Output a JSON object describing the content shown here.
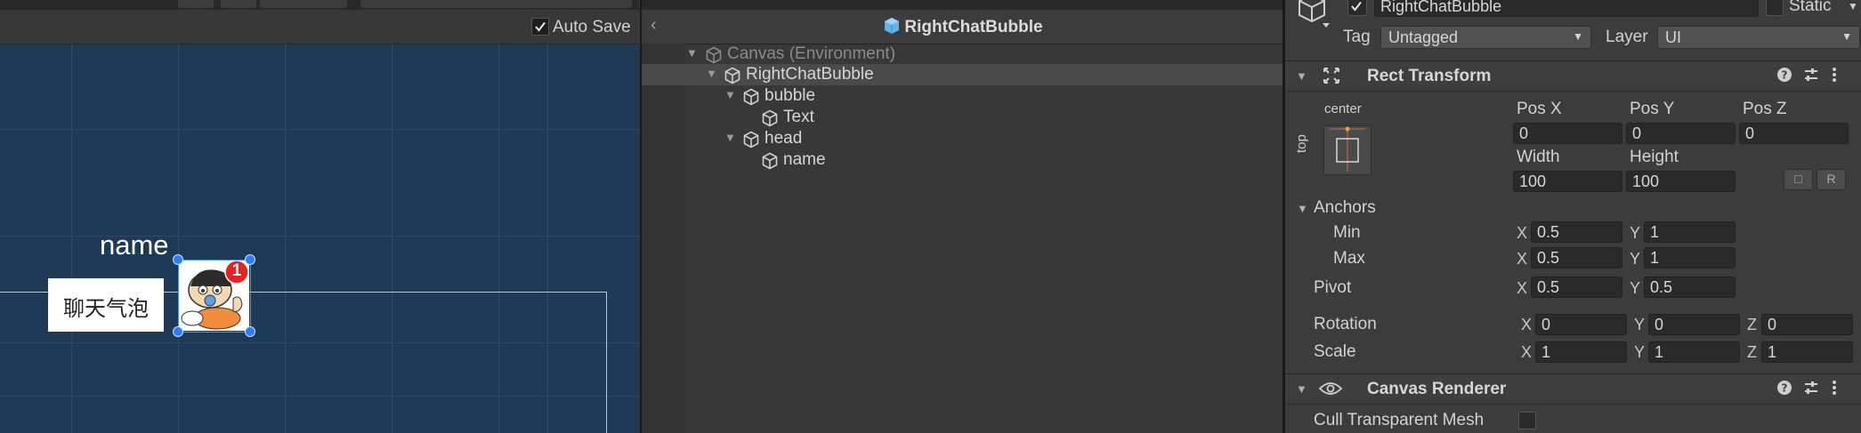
{
  "scene": {
    "autosave_label": "Auto Save",
    "autosave_checked": true,
    "name_label": "name",
    "bubble_text": "聊天气泡",
    "badge_count": "1"
  },
  "hierarchy": {
    "title": "RightChatBubble",
    "back_icon": "chevron-left-icon",
    "items": [
      {
        "label": "Canvas (Environment)",
        "depth": 0,
        "expanded": true,
        "dim": true
      },
      {
        "label": "RightChatBubble",
        "depth": 1,
        "expanded": true,
        "selected": true
      },
      {
        "label": "bubble",
        "depth": 2,
        "expanded": true
      },
      {
        "label": "Text",
        "depth": 3,
        "expanded": false
      },
      {
        "label": "head",
        "depth": 2,
        "expanded": true
      },
      {
        "label": "name",
        "depth": 3,
        "expanded": false
      }
    ]
  },
  "inspector": {
    "object_name": "RightChatBubble",
    "active": true,
    "static_label": "Static",
    "tag_label": "Tag",
    "tag_value": "Untagged",
    "layer_label": "Layer",
    "layer_value": "UI",
    "rect_transform": {
      "title": "Rect Transform",
      "anchor_preset_h": "center",
      "anchor_preset_v": "top",
      "pos_x_label": "Pos X",
      "pos_x": "0",
      "pos_y_label": "Pos Y",
      "pos_y": "0",
      "pos_z_label": "Pos Z",
      "pos_z": "0",
      "width_label": "Width",
      "width": "100",
      "height_label": "Height",
      "height": "100",
      "anchors_label": "Anchors",
      "min_label": "Min",
      "min_x": "0.5",
      "min_y": "1",
      "max_label": "Max",
      "max_x": "0.5",
      "max_y": "1",
      "pivot_label": "Pivot",
      "pivot_x": "0.5",
      "pivot_y": "0.5",
      "rotation_label": "Rotation",
      "rot_x": "0",
      "rot_y": "0",
      "rot_z": "0",
      "scale_label": "Scale",
      "scale_x": "1",
      "scale_y": "1",
      "scale_z": "1",
      "axis_x": "X",
      "axis_y": "Y",
      "axis_z": "Z"
    },
    "canvas_renderer": {
      "title": "Canvas Renderer",
      "cull_label": "Cull Transparent Mesh",
      "cull_checked": false
    }
  }
}
